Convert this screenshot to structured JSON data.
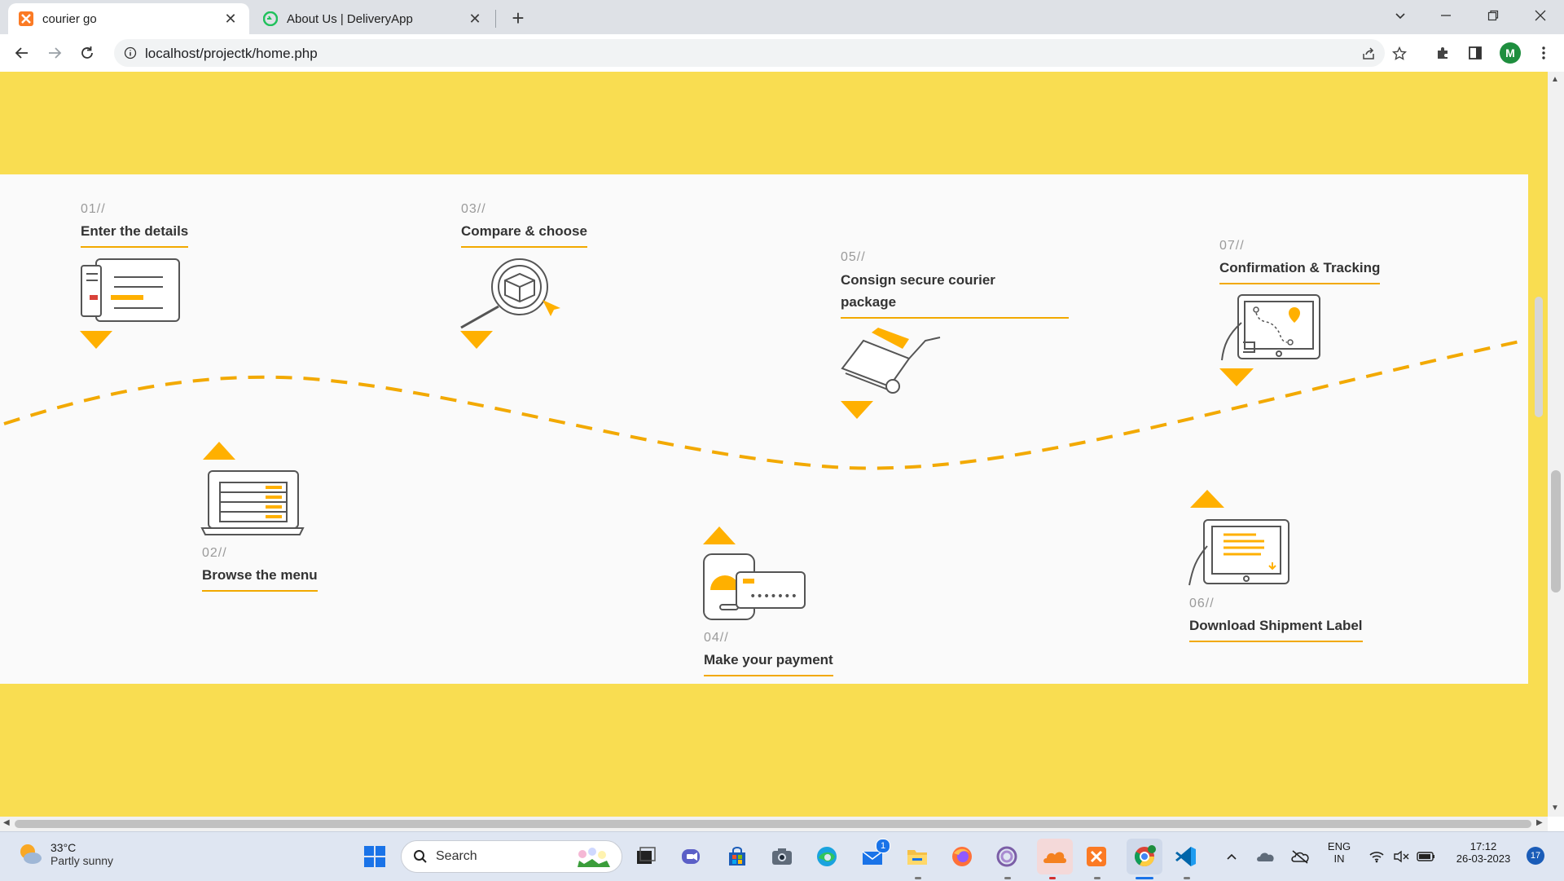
{
  "browser": {
    "tabs": [
      {
        "title": "courier go",
        "active": true,
        "favicon": "xampp-icon"
      },
      {
        "title": "About Us | DeliveryApp",
        "active": false,
        "favicon": "delivery-app-icon"
      }
    ],
    "new_tab_label": "+",
    "url": "localhost/projectk/home.php",
    "profile_initial": "M"
  },
  "steps": [
    {
      "num": "01//",
      "title": "Enter the details",
      "icon": "form-details-icon"
    },
    {
      "num": "02//",
      "title": "Browse the menu",
      "icon": "laptop-menu-icon"
    },
    {
      "num": "03//",
      "title": "Compare & choose",
      "icon": "magnifier-box-icon"
    },
    {
      "num": "04//",
      "title": "Make your payment",
      "icon": "phone-card-payment-icon"
    },
    {
      "num": "05//",
      "title_line1": "Consign secure courier",
      "title_line2": "package",
      "icon": "hand-truck-icon"
    },
    {
      "num": "06//",
      "title": "Download Shipment Label",
      "icon": "tablet-label-icon"
    },
    {
      "num": "07//",
      "title": "Confirmation & Tracking",
      "icon": "tablet-tracking-icon"
    }
  ],
  "colors": {
    "accent": "#f9dd51",
    "arrow": "#ffb000",
    "underline": "#f2a900",
    "background": "#fafafa"
  },
  "taskbar": {
    "weather_temp": "33°C",
    "weather_desc": "Partly sunny",
    "search_label": "Search",
    "lang_line1": "ENG",
    "lang_line2": "IN",
    "time": "17:12",
    "date": "26-03-2023",
    "notification_count": "17",
    "mail_badge": "1"
  }
}
